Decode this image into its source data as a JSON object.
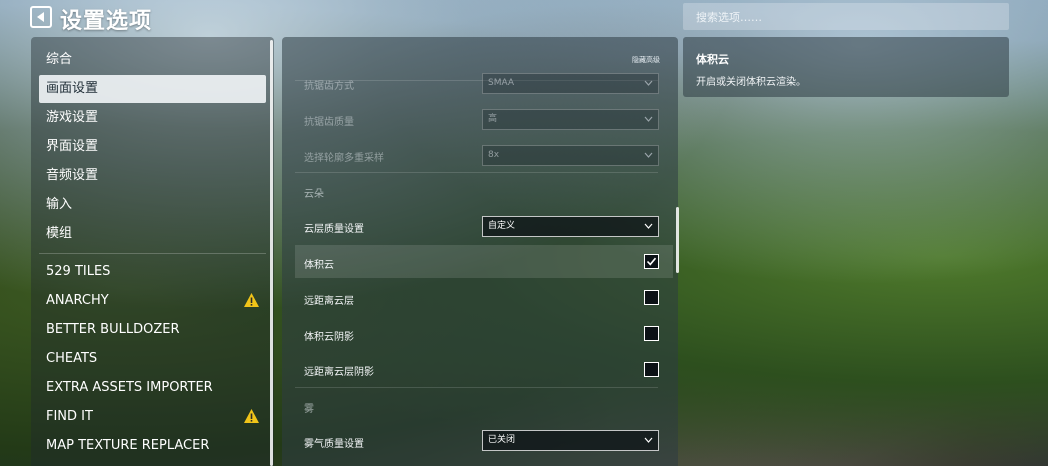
{
  "header": {
    "title": "设置选项",
    "search_placeholder": "搜索选项……"
  },
  "sidebar": {
    "categories": [
      {
        "label": "综合"
      },
      {
        "label": "画面设置",
        "selected": true
      },
      {
        "label": "游戏设置"
      },
      {
        "label": "界面设置"
      },
      {
        "label": "音频设置"
      },
      {
        "label": "输入"
      },
      {
        "label": "模组"
      }
    ],
    "mods": [
      {
        "label": "529 TILES",
        "warning": false
      },
      {
        "label": "ANARCHY",
        "warning": true
      },
      {
        "label": "BETTER BULLDOZER",
        "warning": false
      },
      {
        "label": "CHEATS",
        "warning": false
      },
      {
        "label": "EXTRA ASSETS IMPORTER",
        "warning": false
      },
      {
        "label": "FIND IT",
        "warning": true
      },
      {
        "label": "MAP TEXTURE REPLACER",
        "warning": false
      }
    ]
  },
  "main": {
    "hide_advanced_label": "隐藏高级",
    "rows": [
      {
        "label": "抗锯齿方式",
        "type": "select",
        "value": "SMAA",
        "disabled": true
      },
      {
        "label": "抗锯齿质量",
        "type": "select",
        "value": "高",
        "disabled": true
      },
      {
        "label": "选择轮廓多重采样",
        "type": "select",
        "value": "8x",
        "disabled": true
      },
      {
        "section": "云朵"
      },
      {
        "label": "云层质量设置",
        "type": "select",
        "value": "自定义"
      },
      {
        "label": "体积云",
        "type": "checkbox",
        "checked": true,
        "highlighted": true
      },
      {
        "label": "远距离云层",
        "type": "checkbox",
        "checked": false
      },
      {
        "label": "体积云阴影",
        "type": "checkbox",
        "checked": false
      },
      {
        "label": "远距离云层阴影",
        "type": "checkbox",
        "checked": false
      },
      {
        "section": "雾"
      },
      {
        "label": "雾气质量设置",
        "type": "select",
        "value": "已关闭"
      }
    ]
  },
  "info": {
    "title": "体积云",
    "description": "开启或关闭体积云渲染。"
  },
  "colors": {
    "warning": "#f0c419",
    "selected_bg": "#f5f8fa",
    "selected_text": "#1f2d36"
  }
}
